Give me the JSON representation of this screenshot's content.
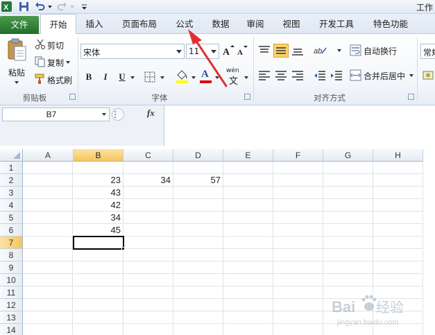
{
  "app": {
    "title_partial": "工作"
  },
  "tabs": [
    {
      "id": "file",
      "label": "文件"
    },
    {
      "id": "home",
      "label": "开始"
    },
    {
      "id": "insert",
      "label": "插入"
    },
    {
      "id": "page_layout",
      "label": "页面布局"
    },
    {
      "id": "formulas",
      "label": "公式"
    },
    {
      "id": "data",
      "label": "数据"
    },
    {
      "id": "review",
      "label": "审阅"
    },
    {
      "id": "view",
      "label": "视图"
    },
    {
      "id": "developer",
      "label": "开发工具"
    },
    {
      "id": "special",
      "label": "特色功能"
    }
  ],
  "ribbon": {
    "clipboard": {
      "paste": "粘贴",
      "cut": "剪切",
      "copy": "复制",
      "format_painter": "格式刷",
      "label": "剪贴板"
    },
    "font": {
      "font_name": "宋体",
      "font_size": "11",
      "bold": "B",
      "italic": "I",
      "underline": "U",
      "font_color_letter": "A",
      "phonetic": "wén",
      "label": "字体",
      "highlight_color": "#ffff00",
      "font_color": "#e00000"
    },
    "alignment": {
      "wrap_text": "自动换行",
      "merge_center": "合并后居中",
      "label": "对齐方式"
    },
    "number": {
      "format_partial": "常规"
    }
  },
  "formula_bar": {
    "name_box": "B7",
    "fx": "fx"
  },
  "grid": {
    "columns": [
      "A",
      "B",
      "C",
      "D",
      "E",
      "F",
      "G",
      "H"
    ],
    "rows": [
      "1",
      "2",
      "3",
      "4",
      "5",
      "6",
      "7",
      "8",
      "9",
      "10",
      "11",
      "12",
      "13",
      "14"
    ],
    "selected_column": "B",
    "selected_row": "7",
    "active_cell": "B7",
    "cells": [
      {
        "ref": "B2",
        "value": "23"
      },
      {
        "ref": "C2",
        "value": "34"
      },
      {
        "ref": "D2",
        "value": "57"
      },
      {
        "ref": "B3",
        "value": "43"
      },
      {
        "ref": "B4",
        "value": "42"
      },
      {
        "ref": "B5",
        "value": "34"
      },
      {
        "ref": "B6",
        "value": "45"
      }
    ]
  },
  "annotation": {
    "arrow_color": "#e03030",
    "target": "公式"
  },
  "watermark": {
    "brand": "Baidu",
    "text": "经验",
    "url": "jingyan.baidu.com"
  }
}
